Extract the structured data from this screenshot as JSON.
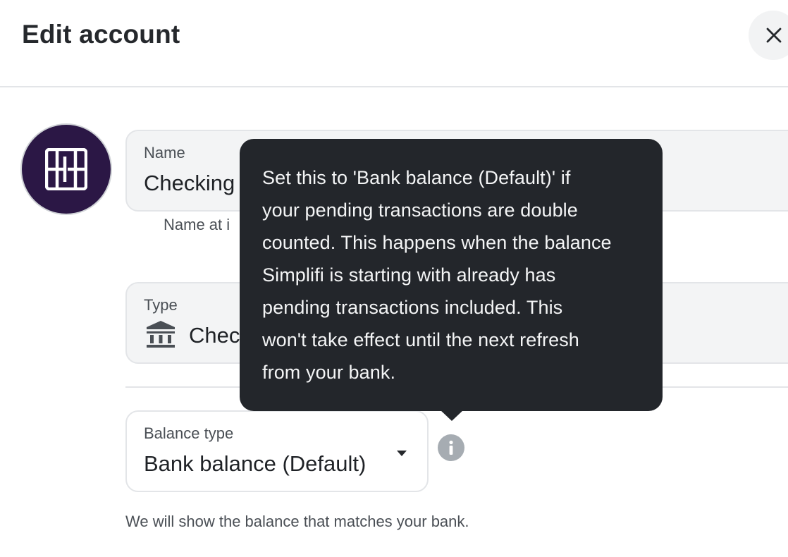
{
  "header": {
    "title": "Edit account",
    "close_icon": "close-icon"
  },
  "avatar": {
    "icon": "institution-logo",
    "color": "#2b1745"
  },
  "name_field": {
    "label": "Name",
    "value": "Checking",
    "helper": "Name at i"
  },
  "type_field": {
    "label": "Type",
    "icon": "bank-icon",
    "value": "Chec"
  },
  "balance_field": {
    "label": "Balance type",
    "value": "Bank balance (Default)",
    "icon": "chevron-down-icon",
    "helper": "We will show the balance that matches your bank."
  },
  "info": {
    "icon": "info-icon"
  },
  "tooltip": {
    "lines": [
      "Set this to 'Bank balance (Default)' if",
      "your pending transactions are double",
      "counted. This happens when the balance",
      "Simplifi is starting with already has",
      "pending transactions included. This",
      "won't take effect until the next refresh",
      "from your bank."
    ],
    "background": "#23262b"
  }
}
